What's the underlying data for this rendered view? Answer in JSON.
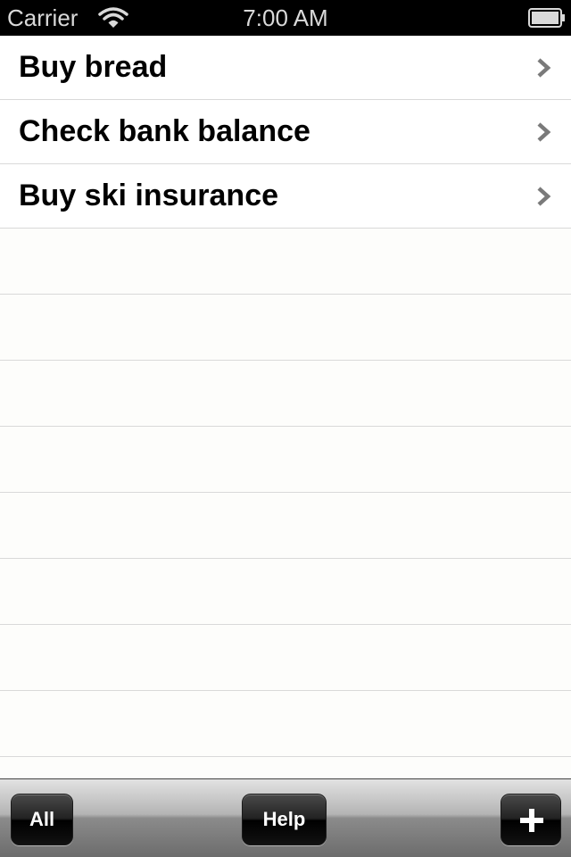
{
  "status_bar": {
    "carrier": "Carrier",
    "time": "7:00 AM",
    "wifi_icon": "wifi-icon",
    "battery_icon": "battery-icon"
  },
  "list": {
    "items": [
      {
        "label": "Buy bread",
        "icon": "chevron-right-icon"
      },
      {
        "label": "Check bank balance",
        "icon": "chevron-right-icon"
      },
      {
        "label": "Buy ski insurance",
        "icon": "chevron-right-icon"
      }
    ]
  },
  "toolbar": {
    "all_label": "All",
    "help_label": "Help",
    "add_icon": "plus-icon"
  },
  "colors": {
    "status_bar_bg": "#000000",
    "list_bg": "#fdfdfb",
    "separator": "#d9d9d9",
    "chevron": "#808080",
    "button_bg": "#111111"
  }
}
